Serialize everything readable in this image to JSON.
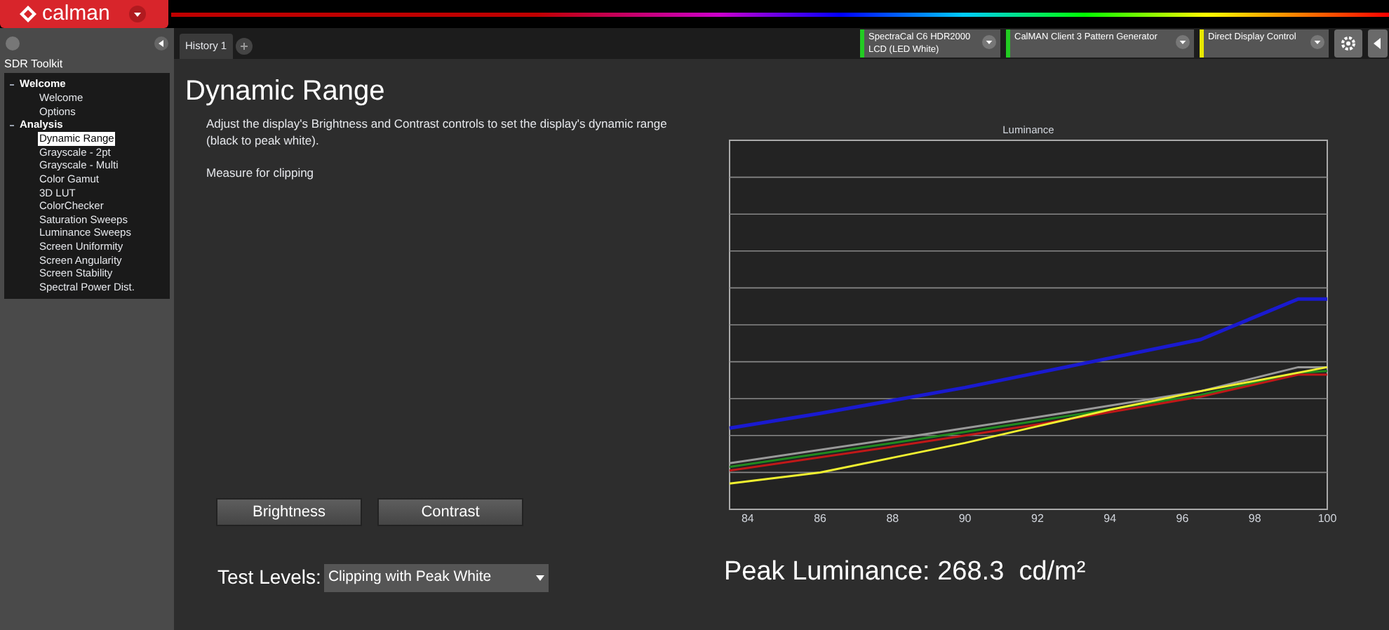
{
  "app": {
    "logo": "calman"
  },
  "sidebar": {
    "title": "SDR Toolkit",
    "tree": [
      {
        "label": "Welcome",
        "expanded": true,
        "children": [
          {
            "label": "Welcome",
            "selected": false
          },
          {
            "label": "Options",
            "selected": false
          }
        ]
      },
      {
        "label": "Analysis",
        "expanded": true,
        "children": [
          {
            "label": "Dynamic Range",
            "selected": true
          },
          {
            "label": "Grayscale - 2pt",
            "selected": false
          },
          {
            "label": "Grayscale - Multi",
            "selected": false
          },
          {
            "label": "Color Gamut",
            "selected": false
          },
          {
            "label": "3D LUT",
            "selected": false
          },
          {
            "label": "ColorChecker",
            "selected": false
          },
          {
            "label": "Saturation Sweeps",
            "selected": false
          },
          {
            "label": "Luminance Sweeps",
            "selected": false
          },
          {
            "label": "Screen Uniformity",
            "selected": false
          },
          {
            "label": "Screen Angularity",
            "selected": false
          },
          {
            "label": "Screen Stability",
            "selected": false
          },
          {
            "label": "Spectral Power Dist.",
            "selected": false
          }
        ]
      }
    ]
  },
  "tabs": [
    {
      "label": "History 1",
      "selected": true
    }
  ],
  "devices": [
    {
      "label": "SpectraCal C6 HDR2000 LCD (LED White)",
      "color": "#22cc22"
    },
    {
      "label": "CalMAN Client 3 Pattern Generator",
      "color": "#22cc22"
    },
    {
      "label": "Direct Display Control",
      "color": "#e8e800"
    }
  ],
  "page": {
    "title": "Dynamic Range",
    "description": "Adjust the display's Brightness and Contrast controls to set the display's dynamic range (black to peak white).",
    "instruction": "Measure for clipping",
    "buttons": [
      "Brightness",
      "Contrast"
    ],
    "test_levels": {
      "label": "Test Levels:",
      "value": "Clipping with Peak White"
    },
    "chart": {
      "title": "Luminance",
      "x_labels": [
        "84",
        "86",
        "88",
        "90",
        "92",
        "94",
        "96",
        "98",
        "100"
      ]
    },
    "peak": "Peak Luminance: 268.3  cd/m²"
  }
}
